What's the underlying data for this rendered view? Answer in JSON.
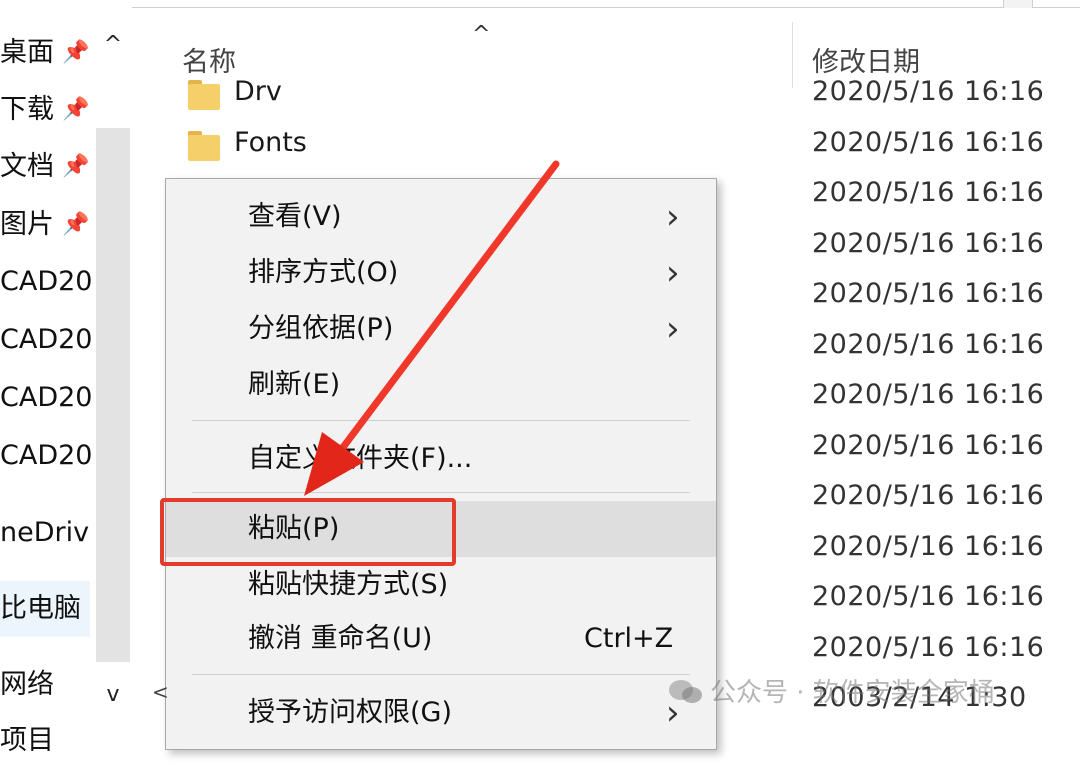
{
  "nav": {
    "items": [
      {
        "label": "桌面",
        "pinned": true
      },
      {
        "label": "下载",
        "pinned": true
      },
      {
        "label": "文档",
        "pinned": true
      },
      {
        "label": "图片",
        "pinned": true
      },
      {
        "label": "CAD20",
        "pinned": false
      },
      {
        "label": "CAD20",
        "pinned": false
      },
      {
        "label": "CAD20",
        "pinned": false
      },
      {
        "label": "CAD20",
        "pinned": false
      },
      {
        "label": "neDriv",
        "pinned": false
      },
      {
        "label": "比电脑",
        "pinned": false
      },
      {
        "label": "网络",
        "pinned": false
      },
      {
        "label": "项目",
        "pinned": false
      }
    ],
    "up_glyph": "^",
    "down_glyph": "v",
    "pin_glyph": "📌"
  },
  "header": {
    "col_name": "名称",
    "col_date": "修改日期",
    "sort_glyph": "^"
  },
  "files": [
    {
      "name": "Drv",
      "date": "2020/5/16 16:16"
    },
    {
      "name": "Fonts",
      "date": "2020/5/16 16:16"
    },
    {
      "name": "",
      "date": "2020/5/16 16:16"
    },
    {
      "name": "",
      "date": "2020/5/16 16:16"
    },
    {
      "name": "",
      "date": "2020/5/16 16:16"
    },
    {
      "name": "",
      "date": "2020/5/16 16:16"
    },
    {
      "name": "",
      "date": "2020/5/16 16:16"
    },
    {
      "name": "",
      "date": "2020/5/16 16:16"
    },
    {
      "name": "",
      "date": "2020/5/16 16:16"
    },
    {
      "name": "",
      "date": "2020/5/16 16:16"
    },
    {
      "name": "",
      "date": "2020/5/16 16:16"
    },
    {
      "name": "",
      "date": "2020/5/16 16:16"
    },
    {
      "name": "",
      "date": "2003/2/14 1:30"
    }
  ],
  "context_menu": {
    "view": "查看(V)",
    "sort_by": "排序方式(O)",
    "group_by": "分组依据(P)",
    "refresh": "刷新(E)",
    "customize": "自定义文件夹(F)...",
    "paste": "粘贴(P)",
    "paste_shortcut": "粘贴快捷方式(S)",
    "undo_rename": "撤消 重命名(U)",
    "undo_shortcut": "Ctrl+Z",
    "grant_access": "授予访问权限(G)",
    "chevron": "›"
  },
  "annotation": {
    "highlight_color": "#e23a2c"
  },
  "watermark": {
    "text": "公众号 · 软件安装全家桶"
  },
  "colors": {
    "accent_red": "#e23a2c",
    "folder": "#f5cf6a",
    "menu_bg": "#f2f2f2"
  }
}
